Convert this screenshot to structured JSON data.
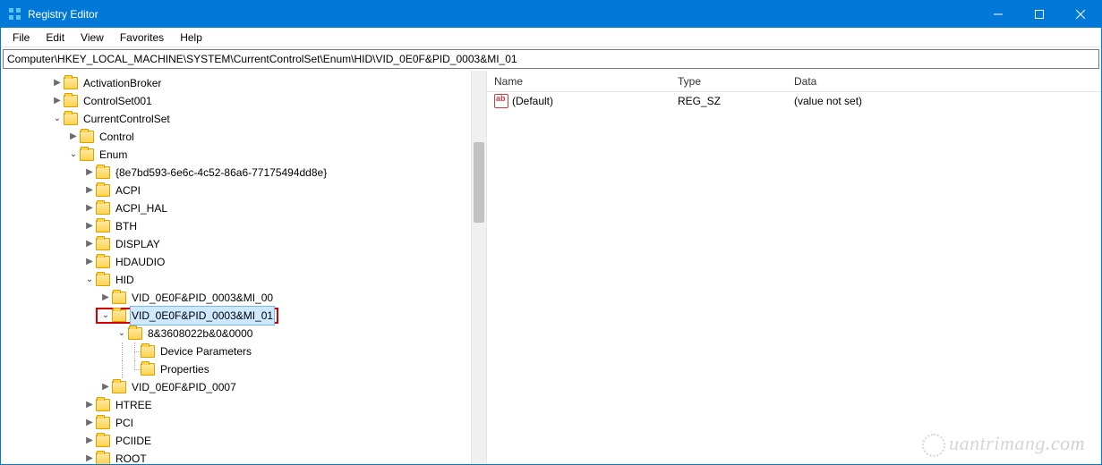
{
  "window": {
    "title": "Registry Editor"
  },
  "menu": {
    "file": "File",
    "edit": "Edit",
    "view": "View",
    "favorites": "Favorites",
    "help": "Help"
  },
  "address": "Computer\\HKEY_LOCAL_MACHINE\\SYSTEM\\CurrentControlSet\\Enum\\HID\\VID_0E0F&PID_0003&MI_01",
  "tree": {
    "activation_broker": "ActivationBroker",
    "controlset001": "ControlSet001",
    "currentcontrolset": "CurrentControlSet",
    "control": "Control",
    "enum": "Enum",
    "guid1": "{8e7bd593-6e6c-4c52-86a6-77175494dd8e}",
    "acpi": "ACPI",
    "acpi_hal": "ACPI_HAL",
    "bth": "BTH",
    "display": "DISPLAY",
    "hdaudio": "HDAUDIO",
    "hid": "HID",
    "vid_mi00": "VID_0E0F&PID_0003&MI_00",
    "vid_mi01": "VID_0E0F&PID_0003&MI_01",
    "instance_key": "8&3608022b&0&0000",
    "device_parameters": "Device Parameters",
    "properties": "Properties",
    "vid_0007": "VID_0E0F&PID_0007",
    "htree": "HTREE",
    "pci": "PCI",
    "pciide": "PCIIDE",
    "root": "ROOT"
  },
  "list": {
    "header_name": "Name",
    "header_type": "Type",
    "header_data": "Data",
    "default_name": "(Default)",
    "default_type": "REG_SZ",
    "default_data": "(value not set)"
  },
  "watermark": "uantrimang"
}
